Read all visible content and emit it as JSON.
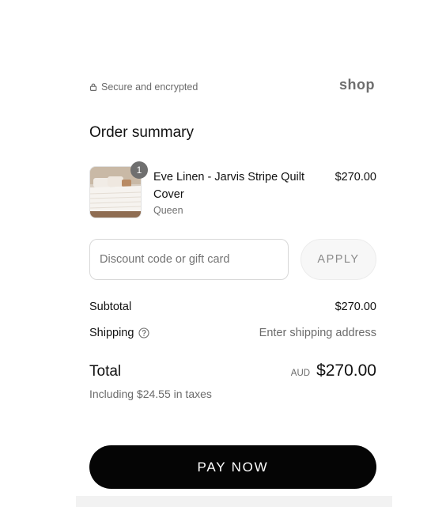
{
  "header": {
    "secure_text": "Secure and encrypted",
    "secure_icon": "lock-icon",
    "brand": "shop"
  },
  "order_summary": {
    "title": "Order summary",
    "items": [
      {
        "quantity": "1",
        "name": "Eve Linen - Jarvis Stripe Quilt Cover",
        "variant": "Queen",
        "price": "$270.00",
        "image": "bedding-product-image"
      }
    ]
  },
  "discount": {
    "placeholder": "Discount code or gift card",
    "value": "",
    "apply_label": "APPLY"
  },
  "totals": {
    "subtotal_label": "Subtotal",
    "subtotal_value": "$270.00",
    "shipping_label": "Shipping",
    "shipping_icon": "help-circle-icon",
    "shipping_value": "Enter shipping address",
    "total_label": "Total",
    "currency": "AUD",
    "total_value": "$270.00",
    "taxes_note": "Including $24.55 in taxes"
  },
  "actions": {
    "pay_label": "PAY NOW"
  },
  "colors": {
    "primary_button": "#050505",
    "badge": "#6f6f6f",
    "muted_text": "#6b6b6b"
  }
}
